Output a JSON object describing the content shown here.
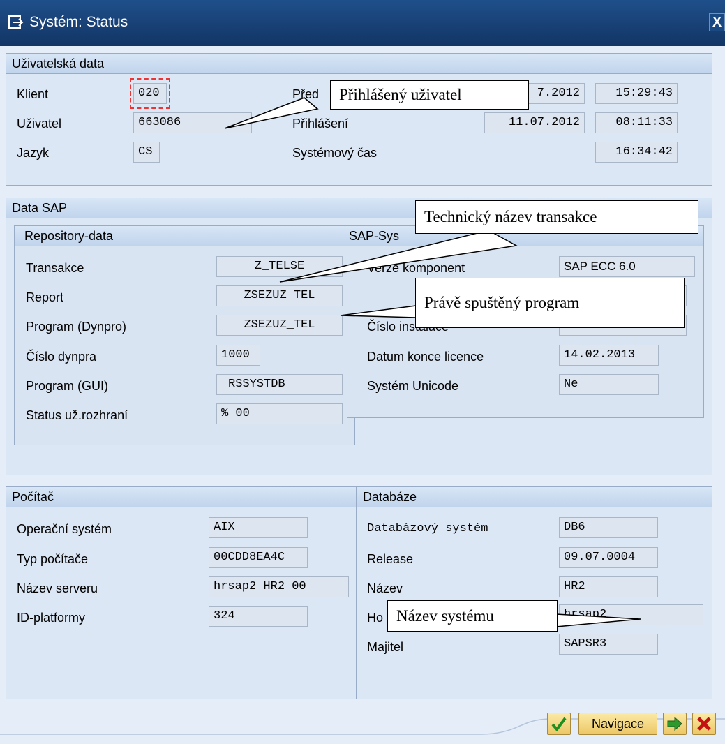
{
  "window": {
    "title": "Systém: Status",
    "close_label": "X"
  },
  "user_data": {
    "header": "Uživatelská data",
    "client_label": "Klient",
    "client_value": "020",
    "user_label": "Uživatel",
    "user_value": "663086",
    "language_label": "Jazyk",
    "language_value": "CS",
    "previous_logon_label": "Před",
    "previous_logon_date": "7.2012",
    "previous_logon_time": "15:29:43",
    "logon_label": "Přihlášení",
    "logon_date": "11.07.2012",
    "logon_time": "08:11:33",
    "system_time_label": "Systémový čas",
    "system_time_value": "16:34:42"
  },
  "sap_data": {
    "header": "Data SAP",
    "repository": {
      "header": "Repository-data",
      "rows": [
        {
          "label": "Transakce",
          "value": "Z_TELSE"
        },
        {
          "label": "Report",
          "value": "ZSEZUZ_TEL"
        },
        {
          "label": "Program (Dynpro)",
          "value": "ZSEZUZ_TEL"
        },
        {
          "label": "Číslo dynpra",
          "value": "1000"
        },
        {
          "label": "Program (GUI)",
          "value": "RSSYSTDB"
        },
        {
          "label": "Status už.rozhraní",
          "value": "%_00"
        }
      ]
    },
    "sap_system": {
      "header": "SAP-Sys",
      "rows": [
        {
          "label": "Verze komponent",
          "value": "SAP ECC 6.0"
        },
        {
          "label": "Číslo instalace",
          "value": ""
        },
        {
          "label": "Datum konce licence",
          "value": "14.02.2013"
        },
        {
          "label": "Systém Unicode",
          "value": "Ne"
        }
      ]
    }
  },
  "computer": {
    "header": "Počítač",
    "rows": [
      {
        "label": "Operační systém",
        "value": "AIX"
      },
      {
        "label": "Typ počítače",
        "value": "00CDD8EA4C"
      },
      {
        "label": "Název serveru",
        "value": "hrsap2_HR2_00"
      },
      {
        "label": "ID-platformy",
        "value": "324"
      }
    ]
  },
  "database": {
    "header": "Databáze",
    "rows": [
      {
        "label": "Databázový systém",
        "value": "DB6"
      },
      {
        "label": "Release",
        "value": "09.07.0004"
      },
      {
        "label": "Název",
        "value": "HR2"
      },
      {
        "label": "Ho",
        "value": "hrsap2"
      },
      {
        "label": "Majitel",
        "value": "SAPSR3"
      }
    ]
  },
  "callouts": {
    "logged_user": "Přihlášený uživatel",
    "transaction": "Technický název transakce",
    "program": "Právě spuštěný program",
    "system_name": "Název systému"
  },
  "buttons": {
    "navigation": "Navigace"
  },
  "colors": {
    "titlebar": "#1a4276",
    "background": "#e4edf8",
    "button": "#f4d57c",
    "confirm": "#1f8f1f",
    "cancel": "#c41212"
  }
}
